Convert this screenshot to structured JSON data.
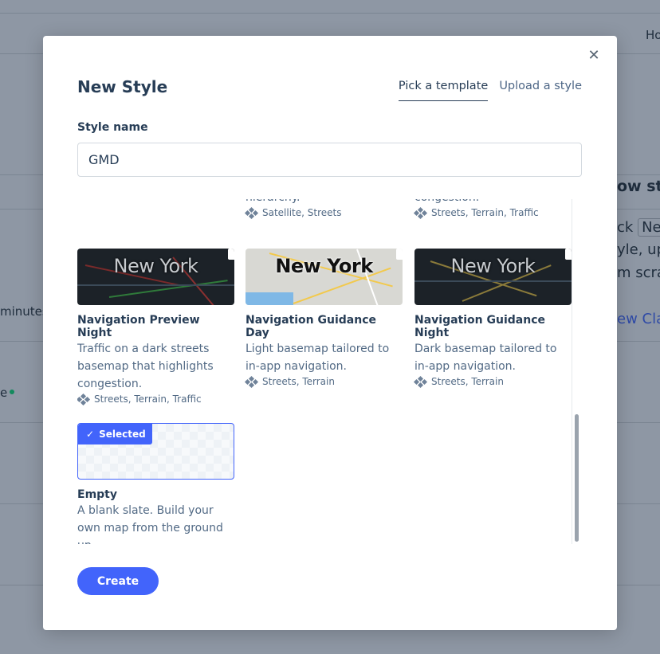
{
  "background": {
    "nav_partial": "Ho",
    "heading_partial": "ow sty",
    "line1_pre": "ck",
    "line1_kbd": "New",
    "line2": "yle, uplo",
    "line3": "m scra",
    "link_partial": "ew Clas",
    "minutes_partial": "minutes",
    "status_partial": "e"
  },
  "modal": {
    "title": "New Style",
    "close_icon": "close-icon",
    "tabs": [
      {
        "label": "Pick a template",
        "active": true
      },
      {
        "label": "Upload a style",
        "active": false
      }
    ],
    "style_name_label": "Style name",
    "style_name_value": "GMD",
    "partial_row": [
      {
        "desc_tail": "hierarchy.",
        "tags": "Satellite, Streets"
      },
      {
        "desc_tail": "congestion.",
        "tags": "Streets, Terrain, Traffic"
      }
    ],
    "templates": [
      {
        "thumb_label": "New York",
        "title": "Navigation Preview Night",
        "desc": "Traffic on a dark streets basemap that highlights congestion.",
        "tags": "Streets, Terrain, Traffic",
        "theme": "dark"
      },
      {
        "thumb_label": "New York",
        "title": "Navigation Guidance Day",
        "desc": "Light basemap tailored to in-app navigation.",
        "tags": "Streets, Terrain",
        "theme": "light"
      },
      {
        "thumb_label": "New York",
        "title": "Navigation Guidance Night",
        "desc": "Dark basemap tailored to in-app navigation.",
        "tags": "Streets, Terrain",
        "theme": "dark"
      },
      {
        "title": "Empty",
        "desc": "A blank slate. Build your own map from the ground up.",
        "selected_label": "Selected",
        "theme": "empty"
      }
    ],
    "create_label": "Create"
  },
  "colors": {
    "accent": "#4264fb",
    "text": "#273d56",
    "muted": "#526a85"
  }
}
